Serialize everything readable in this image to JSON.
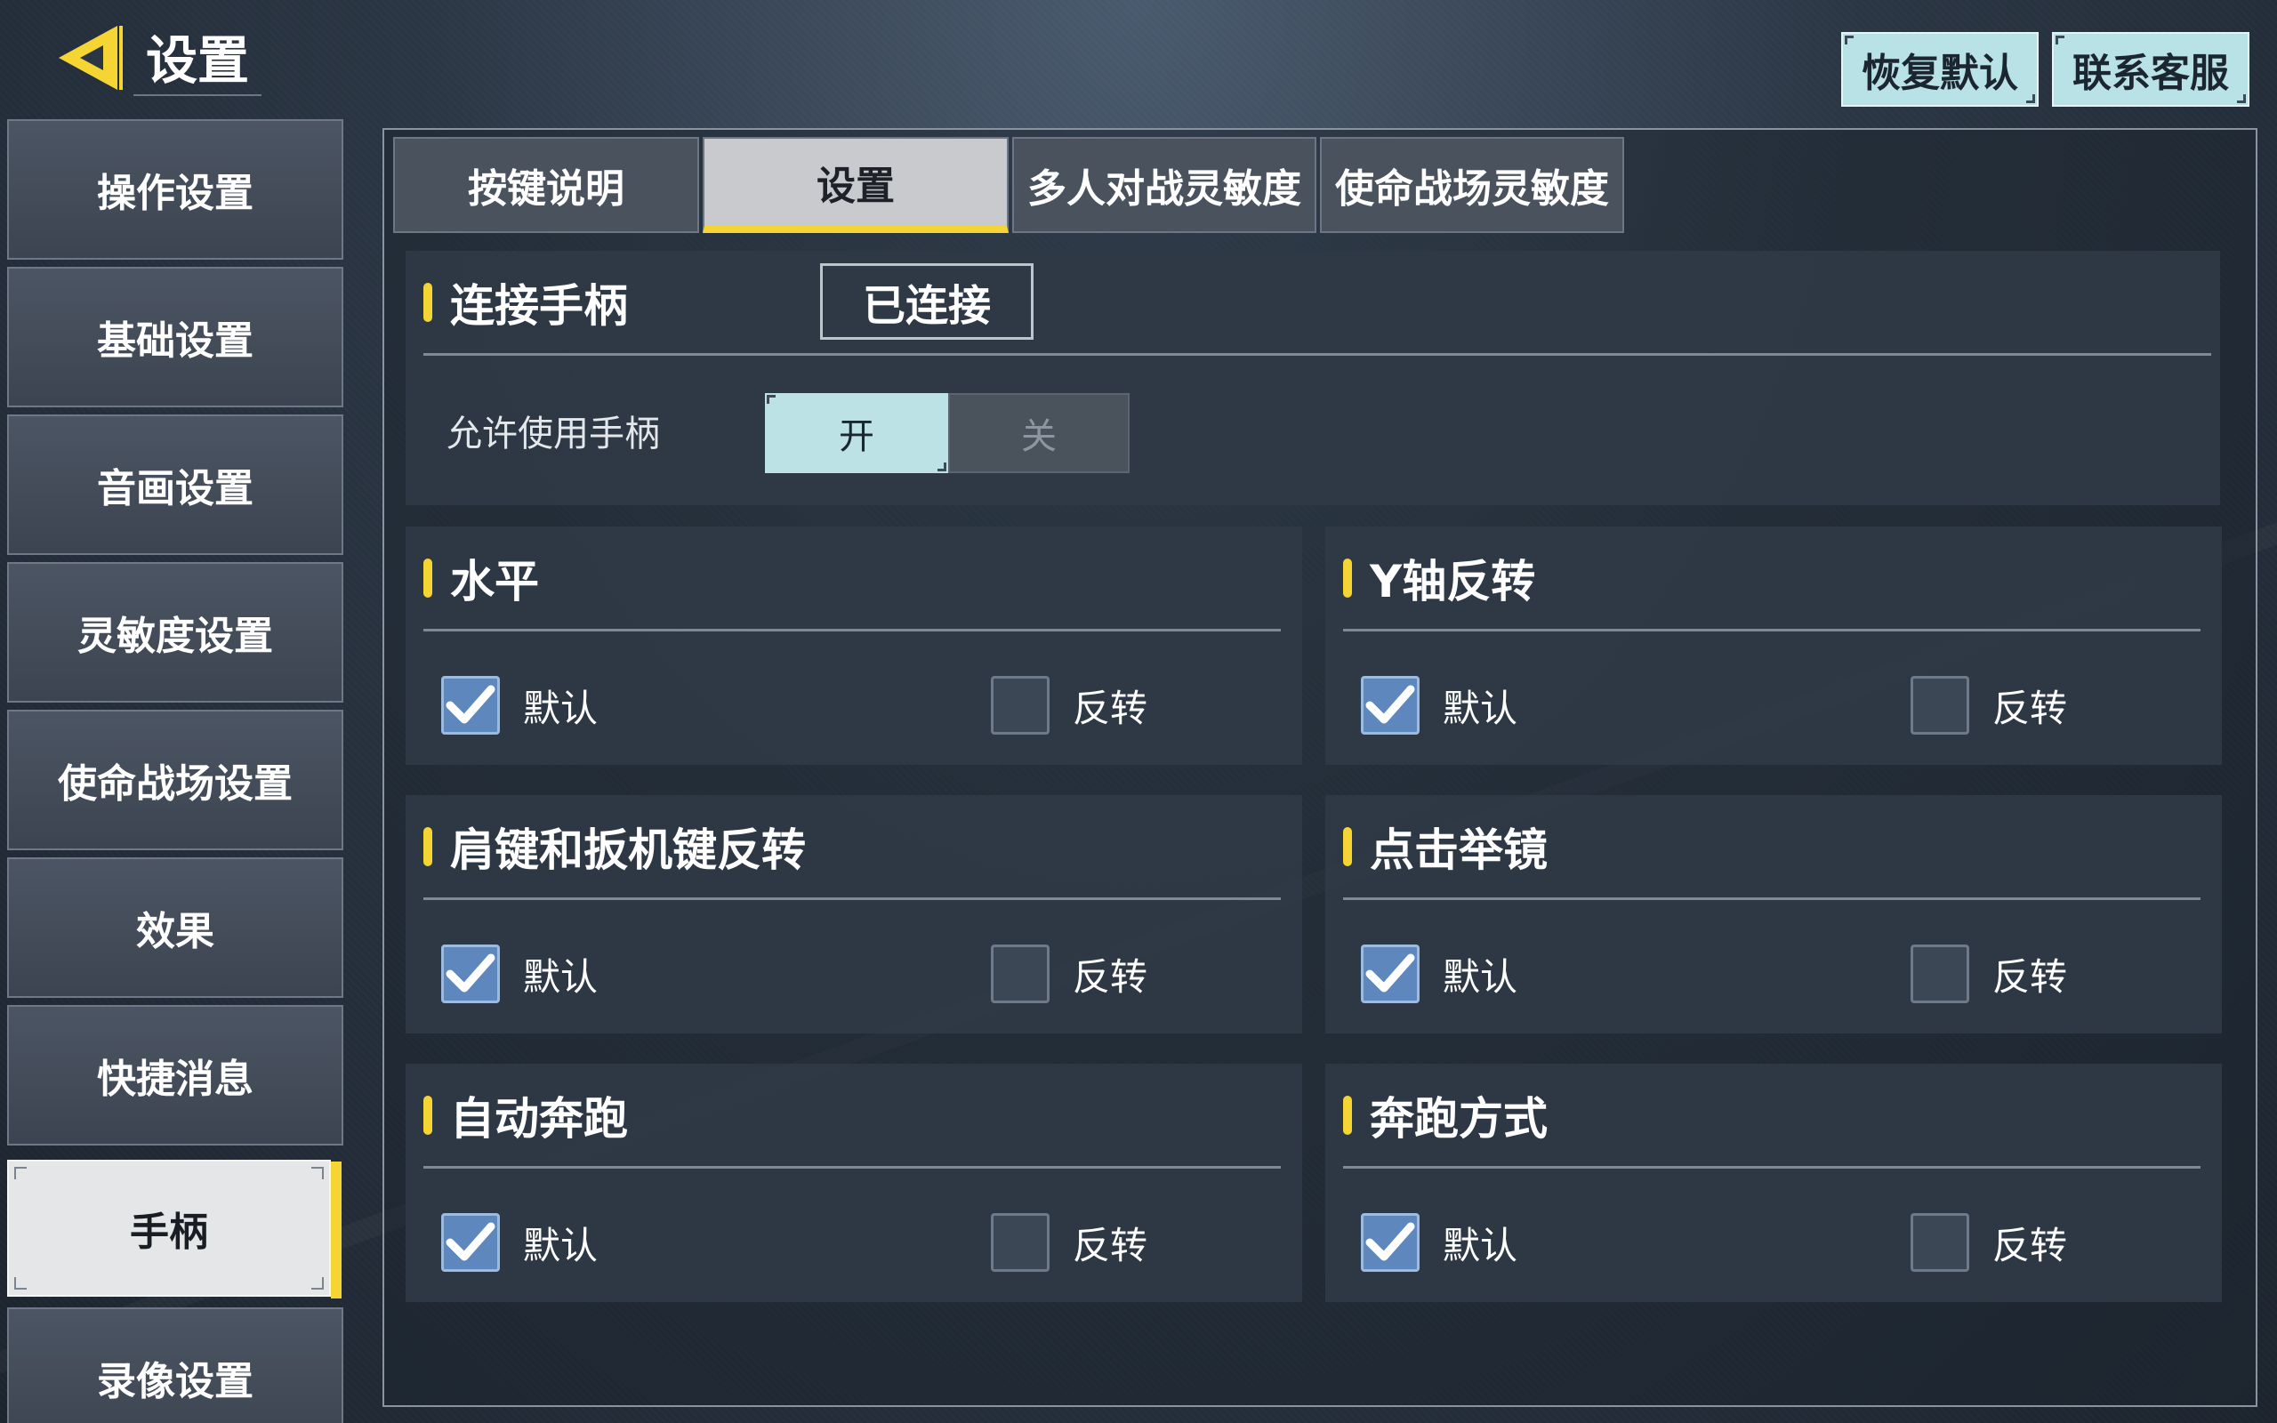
{
  "header": {
    "title": "设置",
    "restore_default": "恢复默认",
    "contact_service": "联系客服"
  },
  "sidebar": {
    "items": [
      {
        "label": "操作设置"
      },
      {
        "label": "基础设置"
      },
      {
        "label": "音画设置"
      },
      {
        "label": "灵敏度设置"
      },
      {
        "label": "使命战场设置"
      },
      {
        "label": "效果"
      },
      {
        "label": "快捷消息"
      },
      {
        "label": "手柄"
      },
      {
        "label": "录像设置"
      }
    ],
    "active_index": 7
  },
  "tabs": [
    {
      "label": "按键说明"
    },
    {
      "label": "设置"
    },
    {
      "label": "多人对战灵敏度"
    },
    {
      "label": "使命战场灵敏度"
    }
  ],
  "controller": {
    "title": "连接手柄",
    "status": "已连接",
    "allow_label": "允许使用手柄",
    "on_label": "开",
    "off_label": "关",
    "enabled": true
  },
  "option_cards": [
    {
      "title": "水平",
      "default_label": "默认",
      "invert_label": "反转",
      "default_checked": true,
      "invert_checked": false
    },
    {
      "title": "Y轴反转",
      "default_label": "默认",
      "invert_label": "反转",
      "default_checked": true,
      "invert_checked": false
    },
    {
      "title": "肩键和扳机键反转",
      "default_label": "默认",
      "invert_label": "反转",
      "default_checked": true,
      "invert_checked": false
    },
    {
      "title": "点击举镜",
      "default_label": "默认",
      "invert_label": "反转",
      "default_checked": true,
      "invert_checked": false
    },
    {
      "title": "自动奔跑",
      "default_label": "默认",
      "invert_label": "反转",
      "default_checked": true,
      "invert_checked": false
    },
    {
      "title": "奔跑方式",
      "default_label": "默认",
      "invert_label": "反转",
      "default_checked": true,
      "invert_checked": false
    }
  ],
  "colors": {
    "accent_yellow": "#f5d533",
    "toggle_on": "#bde2e6",
    "checkbox_checked": "#5d87bd"
  }
}
